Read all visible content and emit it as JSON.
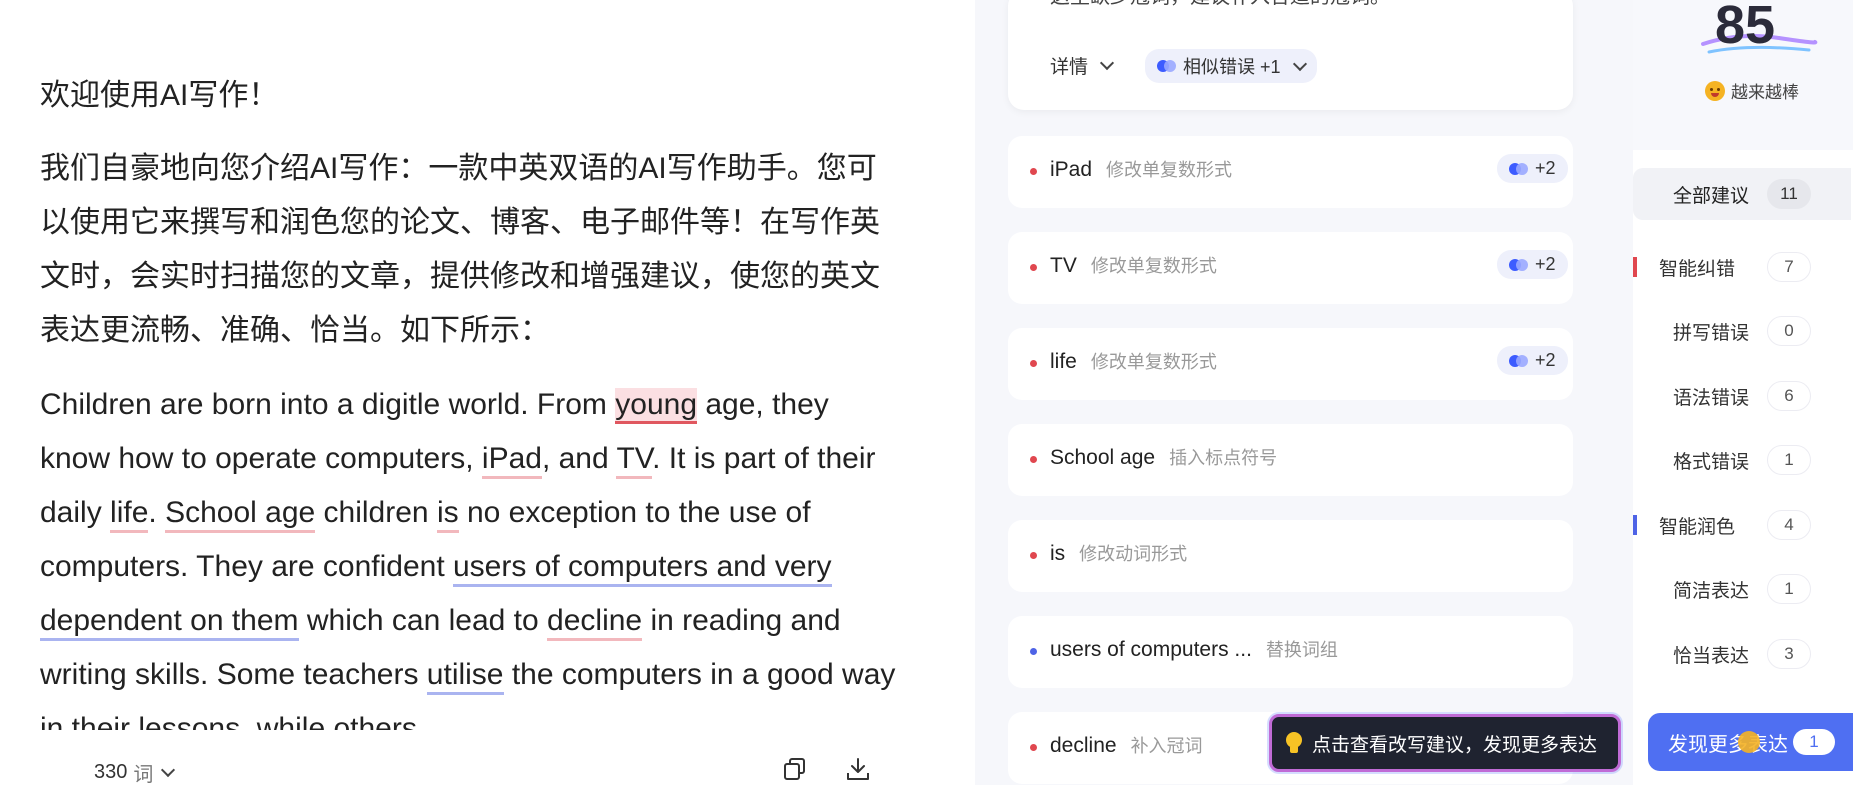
{
  "editor": {
    "greeting": "欢迎使用AI写作！",
    "intro": "我们自豪地向您介绍AI写作：一款中英双语的AI写作助手。您可以使用它来撰写和润色您的论文、博客、电子邮件等！在写作英文时，会实时扫描您的文章，提供修改和增强建议，使您的英文表达更流畅、准确、恰当。如下所示：",
    "essay": {
      "t1": "Children are born into a digitle world. From ",
      "h_young": "young",
      "t2": " age, they know how to operate computers, ",
      "h_ipad": "iPad",
      "t3": ", and ",
      "h_tv": "TV",
      "t4": ". It is part of their daily ",
      "h_life": "life",
      "t5": ". ",
      "h_school": "School age",
      "t6": " children ",
      "h_is": "is",
      "t7": " no exception to the use of computers. They are confident ",
      "h_users": "users of computers and very dependent on them",
      "t8": " which can lead to ",
      "h_decline": "decline",
      "t9": " in reading and writing skills. Some teachers ",
      "h_utilise": "utilise",
      "t10": " the computers in a good way in their lessons, while others"
    },
    "footer": {
      "word_count": "330",
      "word_unit": "词"
    }
  },
  "suggestions": {
    "top_card": {
      "clipped_text": "这里缺少冠词，建议补入合适的冠词。",
      "details_label": "详情",
      "similar_label": "相似错误 +1"
    },
    "items": [
      {
        "word": "iPad",
        "desc": "修改单复数形式",
        "badge": "+2",
        "color": "red"
      },
      {
        "word": "TV",
        "desc": "修改单复数形式",
        "badge": "+2",
        "color": "red"
      },
      {
        "word": "life",
        "desc": "修改单复数形式",
        "badge": "+2",
        "color": "red"
      },
      {
        "word": "School age",
        "desc": "插入标点符号",
        "badge": "",
        "color": "red"
      },
      {
        "word": "is",
        "desc": "修改动词形式",
        "badge": "",
        "color": "red"
      },
      {
        "word": "users of computers ...",
        "desc": "替换词组",
        "badge": "",
        "color": "blue"
      },
      {
        "word": "decline",
        "desc": "补入冠词",
        "badge": "",
        "color": "red"
      }
    ]
  },
  "sidebar": {
    "score": "85",
    "mood": "越来越棒",
    "all": {
      "label": "全部建议",
      "count": "11"
    },
    "categories": [
      {
        "label": "智能纠错",
        "count": "7"
      },
      {
        "label": "拼写错误",
        "count": "0"
      },
      {
        "label": "语法错误",
        "count": "6"
      },
      {
        "label": "格式错误",
        "count": "1"
      },
      {
        "label": "智能润色",
        "count": "4"
      },
      {
        "label": "简洁表达",
        "count": "1"
      },
      {
        "label": "恰当表达",
        "count": "3"
      }
    ]
  },
  "tooltip": {
    "text": "点击查看改写建议，发现更多表达"
  },
  "discover": {
    "label": "发现更多表达",
    "count": "1"
  },
  "colors": {
    "accent": "#4f6ff2",
    "error": "#e0474f",
    "polish": "#4e63e6"
  }
}
